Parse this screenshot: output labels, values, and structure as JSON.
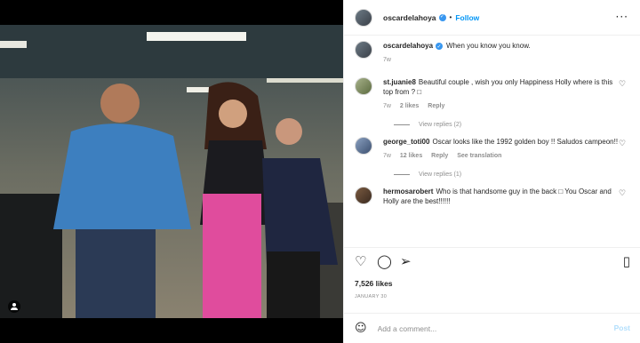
{
  "header": {
    "username": "oscardelahoya",
    "separator": "•",
    "follow_label": "Follow",
    "more_label": "···"
  },
  "caption": {
    "username": "oscardelahoya",
    "text": "When you know you know.",
    "time": "7w"
  },
  "comments": [
    {
      "username": "st.juanie8",
      "text": "Beautiful couple , wish you only Happiness Holly where is this top from ? □",
      "time": "7w",
      "likes": "2 likes",
      "reply": "Reply",
      "view_replies": "View replies (2)"
    },
    {
      "username": "george_toti00",
      "text": "Oscar looks like the 1992 golden boy !! Saludos campeon!!",
      "time": "7w",
      "likes": "12 likes",
      "reply": "Reply",
      "translation": "See translation",
      "view_replies": "View replies (1)"
    },
    {
      "username": "hermosarobert",
      "text": "Who is that handsome guy in the back □ You Oscar and Holly are the best!!!!!!"
    }
  ],
  "actions": {
    "like_icon": "heart-icon",
    "comment_icon": "comment-icon",
    "share_icon": "share-icon",
    "save_icon": "bookmark-icon"
  },
  "likes": "7,526 likes",
  "date": "JANUARY 30",
  "add_comment": {
    "placeholder": "Add a comment...",
    "post_label": "Post"
  },
  "colors": {
    "accent": "#0095f6",
    "verified": "#3897f0",
    "muted": "#8e8e8e"
  }
}
